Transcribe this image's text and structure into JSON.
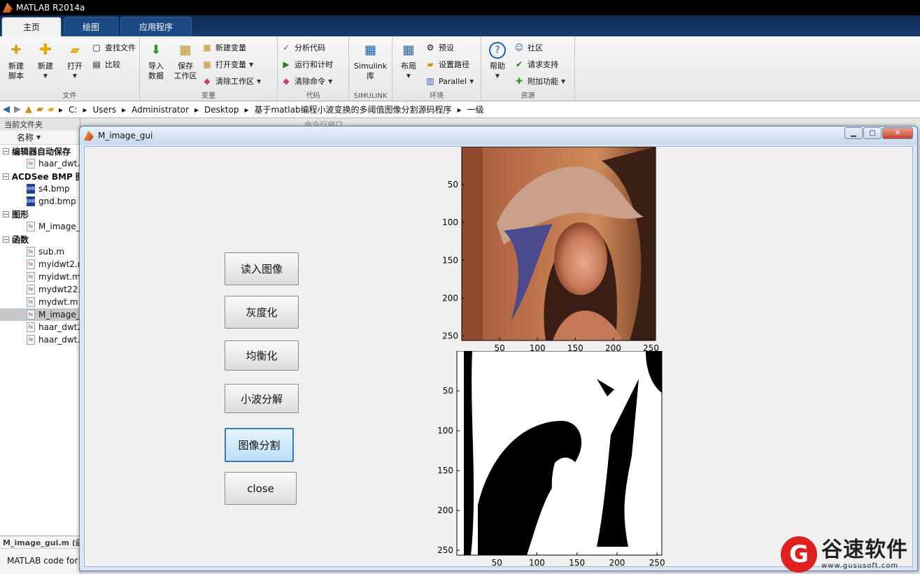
{
  "app": {
    "title": "MATLAB R2014a"
  },
  "tabs": [
    {
      "label": "主页",
      "active": true
    },
    {
      "label": "绘图",
      "active": false
    },
    {
      "label": "应用程序",
      "active": false
    }
  ],
  "ribbon": {
    "file": {
      "label": "文件",
      "new_script": "新建\n脚本",
      "new": "新建",
      "open": "打开",
      "find_files": "查找文件",
      "compare": "比较"
    },
    "variable": {
      "label": "变量",
      "import": "导入\n数据",
      "save_ws": "保存\n工作区",
      "new_var": "新建变量",
      "open_var": "打开变量",
      "clear_ws": "清除工作区"
    },
    "code": {
      "label": "代码",
      "analyze": "分析代码",
      "run_time": "运行和计时",
      "clear_cmd": "清除命令"
    },
    "simulink": {
      "label": "SIMULINK",
      "lib": "Simulink\n库"
    },
    "env": {
      "label": "环境",
      "layout": "布局",
      "prefs": "预设",
      "set_path": "设置路径",
      "parallel": "Parallel"
    },
    "resources": {
      "label": "资源",
      "help": "帮助",
      "community": "社区",
      "support": "请求支持",
      "addons": "附加功能"
    }
  },
  "address": {
    "crumbs": [
      "C:",
      "Users",
      "Administrator",
      "Desktop",
      "基于matlab编程小波变换的多阈值图像分割源码程序",
      "一级"
    ]
  },
  "left_panel": {
    "title": "当前文件夹",
    "col_name": "名称",
    "groups": [
      {
        "label": "编辑器自动保存",
        "files": [
          {
            "name": "haar_dwt.",
            "type": "m"
          }
        ]
      },
      {
        "label": "ACDSee BMP 图",
        "files": [
          {
            "name": "s4.bmp",
            "type": "bmp"
          },
          {
            "name": "gnd.bmp",
            "type": "bmp"
          }
        ]
      },
      {
        "label": "图形",
        "files": [
          {
            "name": "M_image_",
            "type": "fig"
          }
        ]
      },
      {
        "label": "函数",
        "files": [
          {
            "name": "sub.m",
            "type": "m"
          },
          {
            "name": "myidwt2.r",
            "type": "m"
          },
          {
            "name": "myidwt.m",
            "type": "m"
          },
          {
            "name": "mydwt22.",
            "type": "m"
          },
          {
            "name": "mydwt.m",
            "type": "m"
          },
          {
            "name": "M_image_",
            "type": "m",
            "selected": true
          },
          {
            "name": "haar_dwt2",
            "type": "m"
          },
          {
            "name": "haar_dwt.",
            "type": "m"
          }
        ]
      }
    ],
    "detail_name": "M_image_gui.m (函",
    "detail_desc": "MATLAB code for"
  },
  "command_strip": "命令行窗口",
  "gui": {
    "title": "M_image_gui",
    "buttons": [
      "读入图像",
      "灰度化",
      "均衡化",
      "小波分解",
      "图像分割",
      "close"
    ],
    "xticks": [
      "50",
      "100",
      "150",
      "200",
      "250"
    ],
    "yticks": [
      "50",
      "100",
      "150",
      "200",
      "250"
    ]
  },
  "watermark": {
    "text": "谷速软件",
    "url": "www.gususoft.com",
    "logo_letter": "G"
  },
  "colors": {
    "ribbon_tab": "#163b6c",
    "accent": "#3a78c4",
    "watermark_red": "#e02020"
  }
}
